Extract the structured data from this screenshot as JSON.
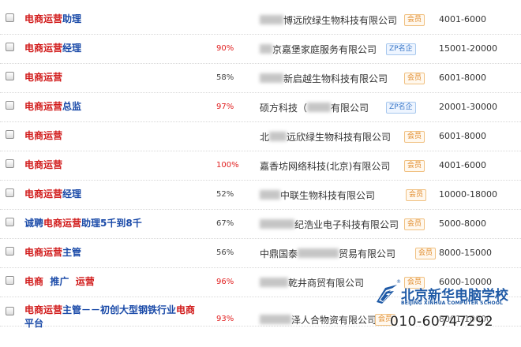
{
  "jobs": [
    {
      "title_parts": [
        {
          "text": "电商运营",
          "tone": "red"
        },
        {
          "text": "助理",
          "tone": "blue"
        }
      ],
      "percent": "",
      "company": {
        "pre": "",
        "blur_w": 30,
        "post": "博远欣绿生物科技有限公司"
      },
      "badge": {
        "text": "会员",
        "kind": "member"
      },
      "salary": "4001-6000"
    },
    {
      "title_parts": [
        {
          "text": "电商运营",
          "tone": "red"
        },
        {
          "text": "经理",
          "tone": "blue"
        }
      ],
      "percent": "90%",
      "company": {
        "pre": "",
        "blur_w": 16,
        "post": "京嘉堡家庭服务有限公司"
      },
      "badge": {
        "text": "ZP名企",
        "kind": "zp"
      },
      "salary": "15001-20000"
    },
    {
      "title_parts": [
        {
          "text": "电商运营",
          "tone": "red"
        }
      ],
      "percent": "58%",
      "company": {
        "pre": "",
        "blur_w": 30,
        "post": "新启越生物科技有限公司"
      },
      "badge": {
        "text": "会员",
        "kind": "member"
      },
      "salary": "6001-8000"
    },
    {
      "title_parts": [
        {
          "text": "电商运营",
          "tone": "red"
        },
        {
          "text": "总监",
          "tone": "blue"
        }
      ],
      "percent": "97%",
      "company": {
        "pre": "硕方科技（",
        "blur_w": 30,
        "post": "有限公司"
      },
      "badge": {
        "text": "ZP名企",
        "kind": "zp"
      },
      "salary": "20001-30000"
    },
    {
      "title_parts": [
        {
          "text": "电商运营",
          "tone": "red"
        }
      ],
      "percent": "",
      "company": {
        "pre": "北",
        "blur_w": 22,
        "post": "远欣绿生物科技有限公司"
      },
      "badge": {
        "text": "会员",
        "kind": "member"
      },
      "salary": "6001-8000"
    },
    {
      "title_parts": [
        {
          "text": "电商运营",
          "tone": "red"
        }
      ],
      "percent": "100%",
      "company": {
        "pre": "嘉香坊网络科技(北京)有限公司",
        "blur_w": 0,
        "post": ""
      },
      "badge": {
        "text": "会员",
        "kind": "member"
      },
      "salary": "4001-6000"
    },
    {
      "title_parts": [
        {
          "text": "电商运营",
          "tone": "red"
        },
        {
          "text": "经理",
          "tone": "blue"
        }
      ],
      "percent": "52%",
      "company": {
        "pre": "",
        "blur_w": 26,
        "post": "中联生物科技有限公司"
      },
      "badge": {
        "text": "会员",
        "kind": "member"
      },
      "salary": "10000-18000"
    },
    {
      "title_parts": [
        {
          "text": "诚聘",
          "tone": "blue"
        },
        {
          "text": "电商运营",
          "tone": "red"
        },
        {
          "text": "助理5千到8千",
          "tone": "blue"
        }
      ],
      "percent": "67%",
      "company": {
        "pre": "",
        "blur_w": 44,
        "post": "纪浩业电子科技有限公司"
      },
      "badge": {
        "text": "会员",
        "kind": "member"
      },
      "salary": "5000-8000"
    },
    {
      "title_parts": [
        {
          "text": "电商运营",
          "tone": "red"
        },
        {
          "text": "主管",
          "tone": "blue"
        }
      ],
      "percent": "56%",
      "company": {
        "pre": "中鼎国泰",
        "blur_w": 52,
        "post": "贸易有限公司"
      },
      "badge": {
        "text": "会员",
        "kind": "member"
      },
      "salary": "8000-15000"
    },
    {
      "title_parts": [
        {
          "text": "电商",
          "tone": "red"
        },
        {
          "text": "  推广  ",
          "tone": "blue"
        },
        {
          "text": "运营",
          "tone": "red"
        }
      ],
      "percent": "96%",
      "company": {
        "pre": "",
        "blur_w": 36,
        "post": "乾井商贸有限公司"
      },
      "badge": {
        "text": "会员",
        "kind": "member"
      },
      "salary": "6000-10000"
    },
    {
      "title_parts": [
        {
          "text": "电商运营",
          "tone": "red"
        },
        {
          "text": "主管－－初创大型钢铁行业",
          "tone": "blue"
        },
        {
          "text": "电商",
          "tone": "red"
        },
        {
          "text": "平台",
          "tone": "blue"
        }
      ],
      "percent": "93%",
      "company": {
        "pre": "",
        "blur_w": 40,
        "post": "泽人合物资有限公司"
      },
      "badge": {
        "text": "会员",
        "kind": "member"
      },
      "salary": "8001-10000"
    }
  ],
  "watermark": {
    "name": "北京新华电脑学校",
    "subtitle": "BEIJING XINHUA COMPUTER SCHOOL",
    "reg": "®",
    "phone": "010-60747292",
    "logo_icon": "xinhua-swoosh-icon",
    "color": "#1f5aa6"
  },
  "colors": {
    "keyword_red": "#d11a1a",
    "title_blue": "#1a4aa8",
    "percent_red": "#e11f1f",
    "member_orange": "#e08a2a",
    "zp_blue": "#3a78c8"
  }
}
